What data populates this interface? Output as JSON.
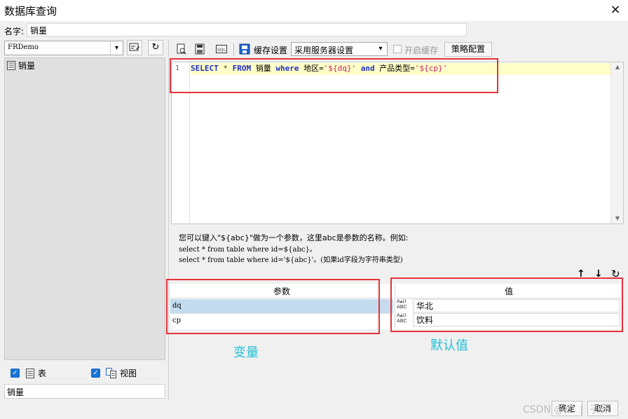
{
  "window": {
    "title": "数据库查询",
    "close_icon": "×"
  },
  "name_field": {
    "label": "名字:",
    "value": "销量"
  },
  "left": {
    "datasource_value": "FRDemo",
    "tree_items": [
      {
        "label": "销量"
      }
    ],
    "show_tables_label": "表",
    "show_views_label": "视图",
    "filter_value": "销量"
  },
  "toolbar": {
    "cache_settings_label": "缓存设置",
    "cache_mode_value": "采用服务器设置",
    "enable_cache_label": "开启缓存",
    "strategy_label": "策略配置"
  },
  "editor": {
    "line_number": "1",
    "sql_tokens": [
      {
        "t": "SELECT",
        "c": "kw"
      },
      {
        "t": " * ",
        "c": "op"
      },
      {
        "t": "FROM",
        "c": "kw"
      },
      {
        "t": " 销量 ",
        "c": ""
      },
      {
        "t": "where",
        "c": "kw"
      },
      {
        "t": " 地区=",
        "c": ""
      },
      {
        "t": "'${dq}'",
        "c": "str"
      },
      {
        "t": " ",
        "c": ""
      },
      {
        "t": "and",
        "c": "kw"
      },
      {
        "t": " 产品类型=",
        "c": ""
      },
      {
        "t": "'${cp}'",
        "c": "str"
      }
    ]
  },
  "hint": {
    "line1": "您可以键入\"${abc}\"做为一个参数，这里abc是参数的名称。例如:",
    "line2": "select * from table where id=${abc}。",
    "line3": "select * from table where id='${abc}'。(如果id字段为字符串类型)"
  },
  "params": {
    "header_param": "参数",
    "header_value": "值",
    "rows": [
      {
        "name": "dq",
        "value": "华北"
      },
      {
        "name": "cp",
        "value": "饮料"
      }
    ],
    "type_badge": "ABC"
  },
  "annotations": {
    "variable": "变量",
    "default_value": "默认值"
  },
  "footer": {
    "ok_label": "确定",
    "cancel_label": "取消",
    "watermark": "CSDN @扛  |  子矸"
  },
  "colors": {
    "annotation_box": "#e8323c",
    "annotation_text": "#25c0d8",
    "selected_row": "#c5dcee",
    "code_line_highlight": "#ffffc8"
  }
}
